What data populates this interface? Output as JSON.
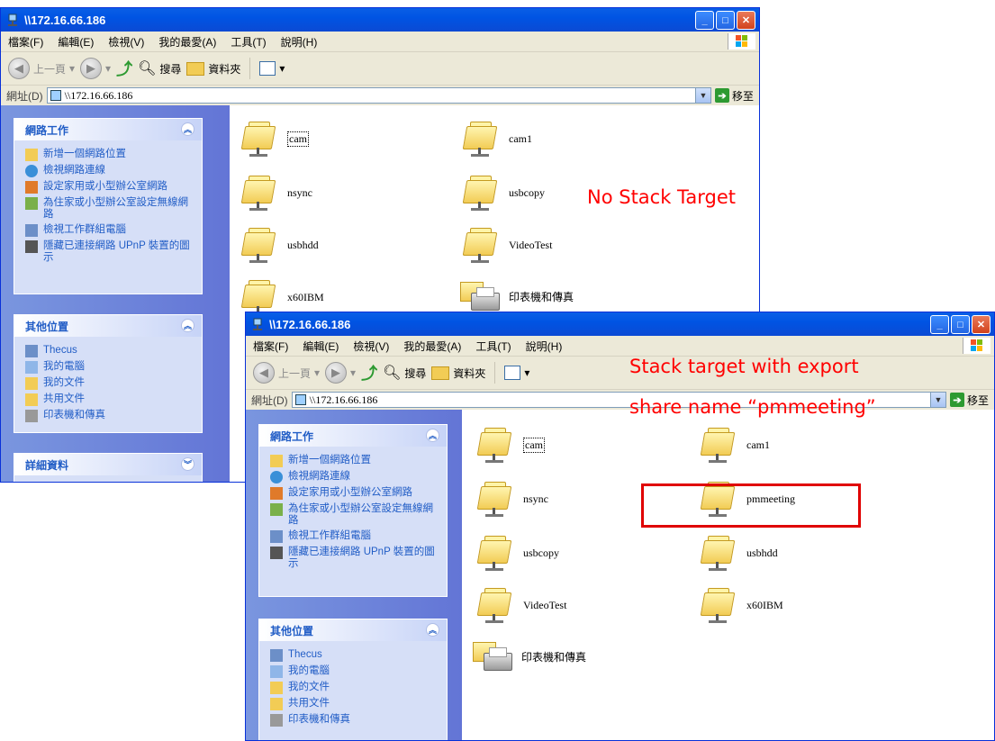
{
  "back_window": {
    "title": "\\\\172.16.66.186",
    "menu": [
      "檔案(F)",
      "編輯(E)",
      "檢視(V)",
      "我的最愛(A)",
      "工具(T)",
      "說明(H)"
    ],
    "toolbar": {
      "back": "上一頁",
      "search": "搜尋",
      "folders": "資料夾"
    },
    "address": {
      "label": "網址(D)",
      "value": "\\\\172.16.66.186",
      "go": "移至"
    },
    "network_tasks": {
      "title": "網路工作",
      "links": [
        "新增一個網路位置",
        "檢視網路連線",
        "設定家用或小型辦公室網路",
        "為住家或小型辦公室設定無線網路",
        "檢視工作群組電腦",
        "隱藏已連接網路 UPnP 裝置的圖示"
      ]
    },
    "other_places": {
      "title": "其他位置",
      "links": [
        "Thecus",
        "我的電腦",
        "我的文件",
        "共用文件",
        "印表機和傳真"
      ]
    },
    "details": {
      "title": "詳細資料"
    },
    "items": [
      "cam",
      "cam1",
      "nsync",
      "usbcopy",
      "usbhdd",
      "VideoTest",
      "x60IBM",
      "印表機和傳真"
    ]
  },
  "front_window": {
    "title": "\\\\172.16.66.186",
    "menu": [
      "檔案(F)",
      "編輯(E)",
      "檢視(V)",
      "我的最愛(A)",
      "工具(T)",
      "說明(H)"
    ],
    "toolbar": {
      "back": "上一頁",
      "search": "搜尋",
      "folders": "資料夾"
    },
    "address": {
      "label": "網址(D)",
      "value": "\\\\172.16.66.186",
      "go": "移至"
    },
    "network_tasks": {
      "title": "網路工作",
      "links": [
        "新增一個網路位置",
        "檢視網路連線",
        "設定家用或小型辦公室網路",
        "為住家或小型辦公室設定無線網路",
        "檢視工作群組電腦",
        "隱藏已連接網路 UPnP 裝置的圖示"
      ]
    },
    "other_places": {
      "title": "其他位置",
      "links": [
        "Thecus",
        "我的電腦",
        "我的文件",
        "共用文件",
        "印表機和傳真"
      ]
    },
    "items": [
      "cam",
      "cam1",
      "nsync",
      "pmmeeting",
      "usbcopy",
      "usbhdd",
      "VideoTest",
      "x60IBM",
      "印表機和傳真"
    ]
  },
  "annotations": {
    "no_stack": "No Stack Target",
    "stack_line1": "Stack target with export",
    "stack_line2": "share name “pmmeeting”",
    "color": "#ff0000"
  }
}
